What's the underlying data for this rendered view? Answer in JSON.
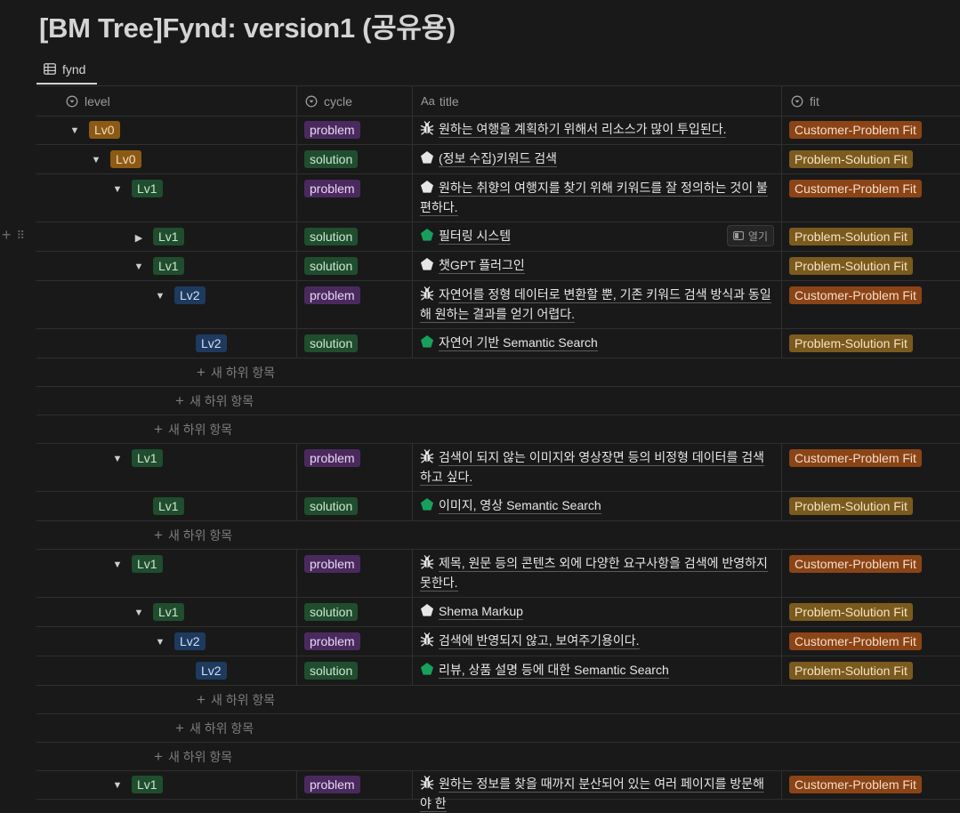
{
  "page": {
    "title": "[BM Tree]Fynd: version1 (공유용)"
  },
  "view": {
    "tab_label": "fynd",
    "tab_icon": "table-icon"
  },
  "columns": [
    {
      "label": "level",
      "icon": "select-property-icon"
    },
    {
      "label": "cycle",
      "icon": "select-property-icon"
    },
    {
      "label": "title",
      "icon": "text-property-icon",
      "icon_text": "Aa"
    },
    {
      "label": "fit",
      "icon": "select-property-icon"
    }
  ],
  "row_actions": {
    "open_label": "열기",
    "new_sub_label": "새 하위 항목"
  },
  "rows": [
    {
      "level": "Lv0",
      "cycle": "problem",
      "title": "원하는 여행을 계획하기 위해서 리소스가 많이 투입된다.",
      "icon": "bug-icon",
      "fit": "Customer-Problem Fit",
      "toggle": "expanded"
    },
    {
      "level": "Lv0",
      "cycle": "solution",
      "title": "(정보 수집)키워드 검색",
      "icon": "white-pentagon-icon",
      "fit": "Problem-Solution Fit",
      "toggle": "expanded"
    },
    {
      "level": "Lv1",
      "cycle": "problem",
      "title": "원하는 취향의 여행지를 찾기 위해 키워드를 잘 정의하는 것이 불편하다.",
      "icon": "white-pentagon-icon",
      "fit": "Customer-Problem Fit",
      "toggle": "expanded"
    },
    {
      "level": "Lv1",
      "cycle": "solution",
      "title": "필터링 시스템",
      "icon": "green-pentagon-icon",
      "fit": "Problem-Solution Fit",
      "toggle": "collapsed"
    },
    {
      "level": "Lv1",
      "cycle": "solution",
      "title": "챗GPT 플러그인",
      "icon": "white-pentagon-icon",
      "fit": "Problem-Solution Fit",
      "toggle": "expanded"
    },
    {
      "level": "Lv2",
      "cycle": "problem",
      "title": "자연어를 정형 데이터로 변환할 뿐, 기존 키워드 검색 방식과 동일해 원하는 결과를 얻기 어렵다.",
      "icon": "bug-icon",
      "fit": "Customer-Problem Fit",
      "toggle": "expanded"
    },
    {
      "level": "Lv2",
      "cycle": "solution",
      "title": "자연어 기반 Semantic Search",
      "icon": "green-pentagon-icon",
      "fit": "Problem-Solution Fit",
      "toggle": "none"
    },
    {
      "level": "Lv1",
      "cycle": "problem",
      "title": "검색이 되지 않는 이미지와 영상장면 등의 비정형 데이터를 검색하고 싶다.",
      "icon": "bug-icon",
      "fit": "Customer-Problem Fit",
      "toggle": "expanded"
    },
    {
      "level": "Lv1",
      "cycle": "solution",
      "title": "이미지, 영상 Semantic Search",
      "icon": "green-pentagon-icon",
      "fit": "Problem-Solution Fit",
      "toggle": "none"
    },
    {
      "level": "Lv1",
      "cycle": "problem",
      "title": "제목, 원문 등의 콘텐츠 외에 다양한 요구사항을 검색에 반영하지 못한다.",
      "icon": "bug-icon",
      "fit": "Customer-Problem Fit",
      "toggle": "expanded"
    },
    {
      "level": "Lv1",
      "cycle": "solution",
      "title": "Shema Markup",
      "icon": "white-pentagon-icon",
      "fit": "Problem-Solution Fit",
      "toggle": "expanded"
    },
    {
      "level": "Lv2",
      "cycle": "problem",
      "title": "검색에 반영되지 않고, 보여주기용이다.",
      "icon": "bug-icon",
      "fit": "Customer-Problem Fit",
      "toggle": "expanded"
    },
    {
      "level": "Lv2",
      "cycle": "solution",
      "title": "리뷰, 상품 설명 등에 대한 Semantic Search",
      "icon": "green-pentagon-icon",
      "fit": "Problem-Solution Fit",
      "toggle": "none"
    },
    {
      "level": "Lv1",
      "cycle": "problem",
      "title": "원하는 정보를 찾을 때까지 분산되어 있는 여러 페이지를 방문해야 한",
      "icon": "bug-icon",
      "fit": "Customer-Problem Fit",
      "toggle": "expanded"
    }
  ]
}
